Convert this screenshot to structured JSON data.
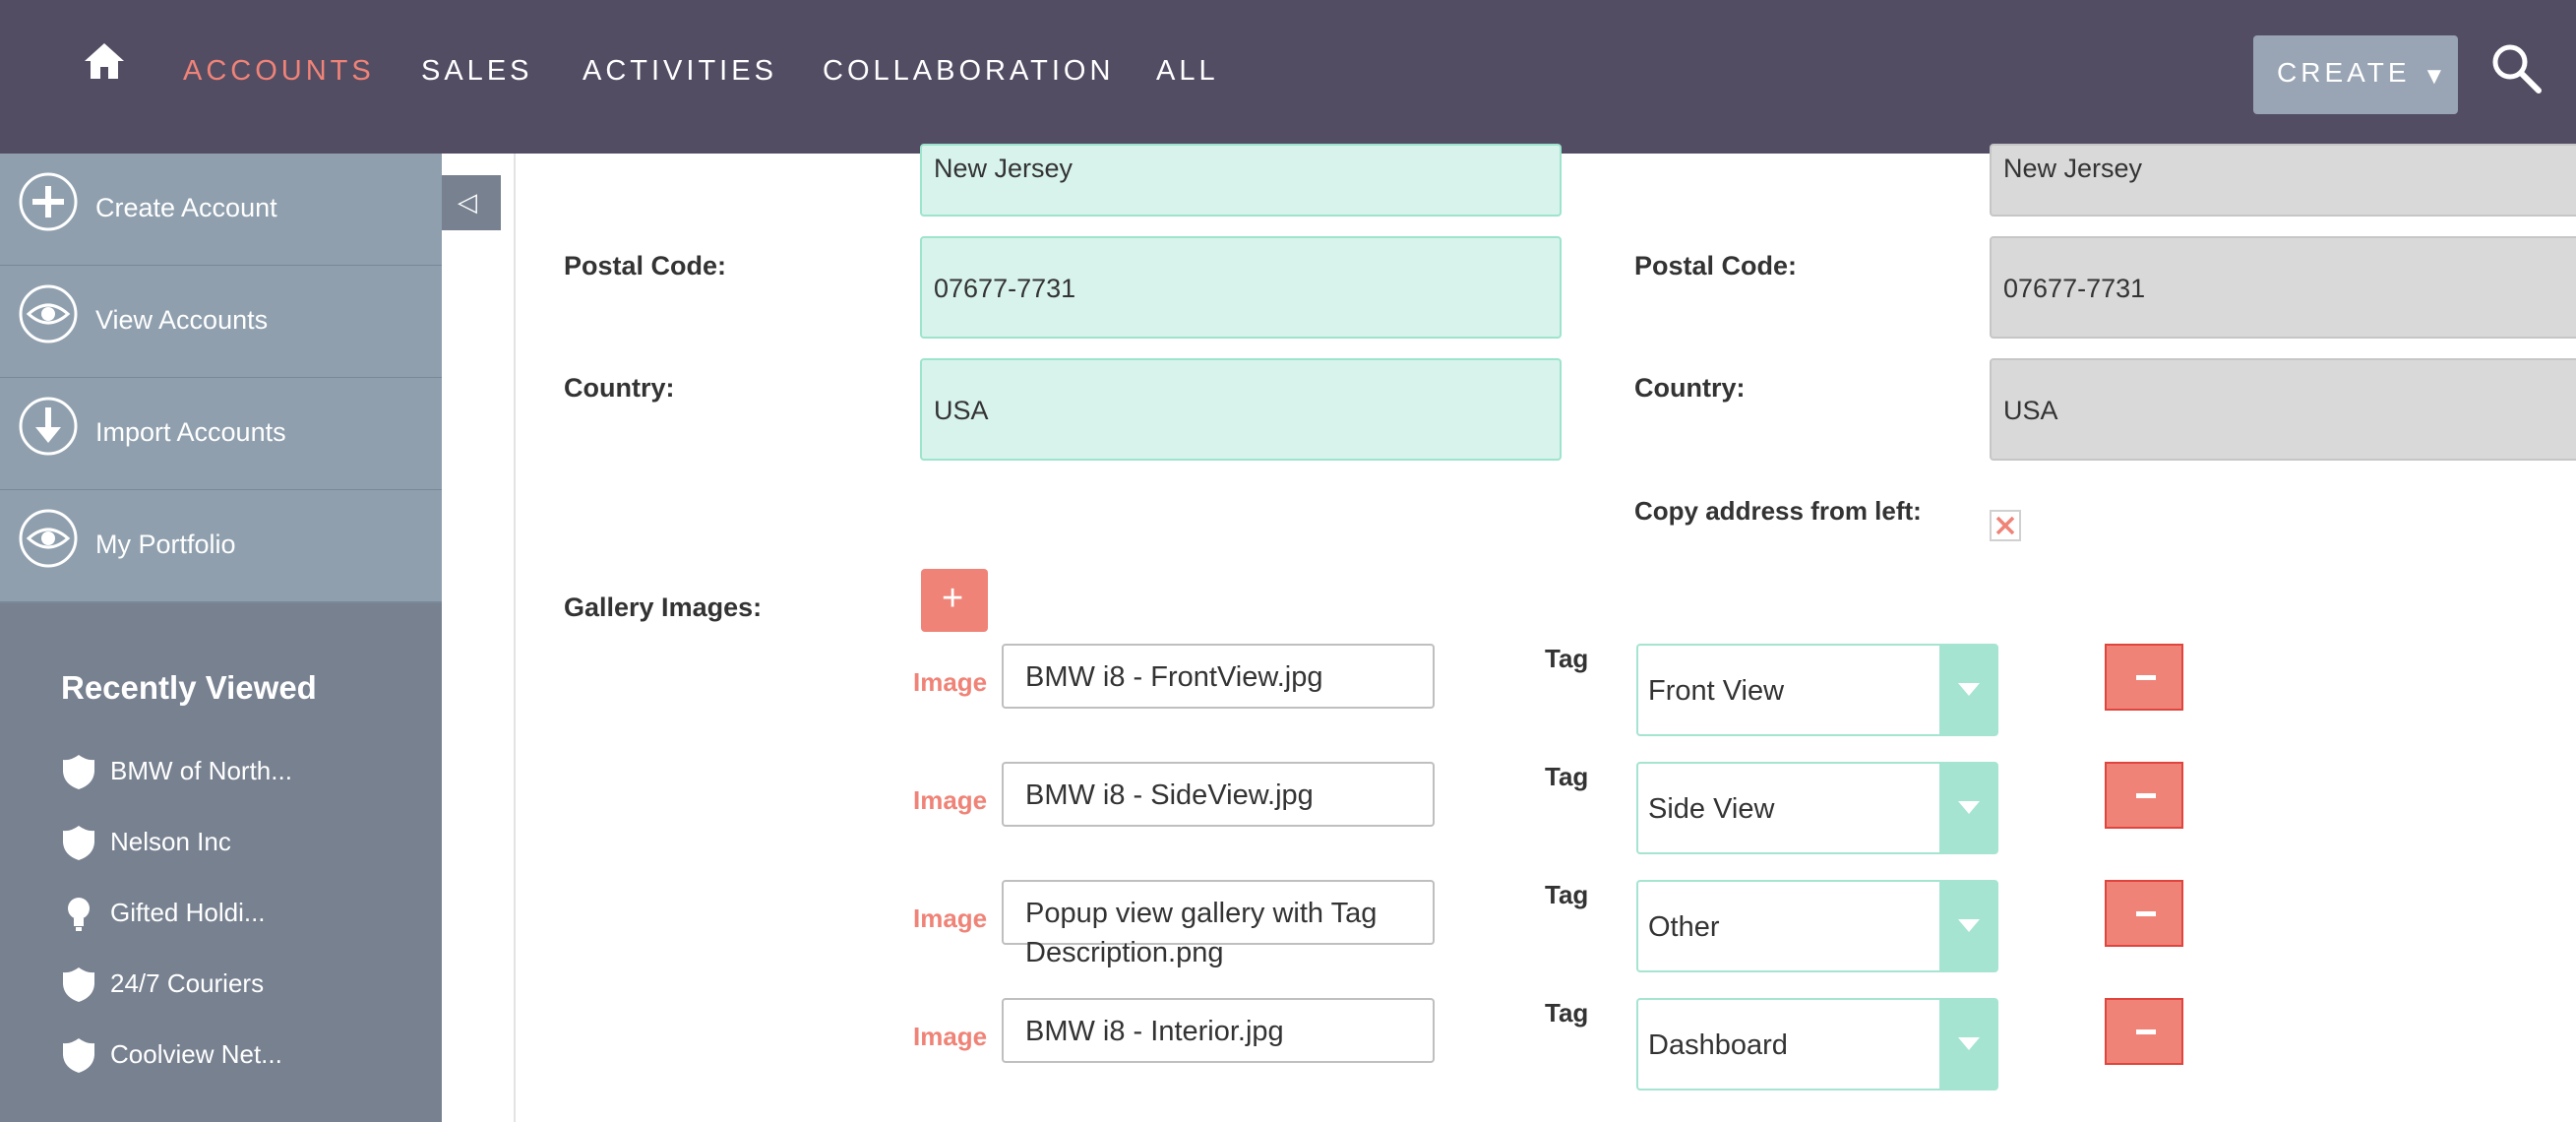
{
  "nav": {
    "items": [
      {
        "label": "ACCOUNTS",
        "active": true
      },
      {
        "label": "SALES",
        "active": false
      },
      {
        "label": "ACTIVITIES",
        "active": false
      },
      {
        "label": "COLLABORATION",
        "active": false
      },
      {
        "label": "ALL",
        "active": false
      }
    ],
    "create_label": "CREATE",
    "create_caret": "▼",
    "colors": {
      "bar": "#534d64",
      "active": "#f08377",
      "create_bg": "#99a5b4"
    }
  },
  "sidebar": {
    "actions": [
      {
        "label": "Create Account",
        "icon": "plus-circle-icon"
      },
      {
        "label": "View Accounts",
        "icon": "eye-icon"
      },
      {
        "label": "Import Accounts",
        "icon": "download-arrow-icon"
      },
      {
        "label": "My Portfolio",
        "icon": "eye-icon"
      }
    ],
    "recently_viewed_title": "Recently Viewed",
    "recent_items": [
      {
        "label": "BMW of North...",
        "icon": "shield-icon"
      },
      {
        "label": "Nelson Inc",
        "icon": "shield-icon"
      },
      {
        "label": "Gifted Holdi...",
        "icon": "lightbulb-icon"
      },
      {
        "label": "24/7 Couriers",
        "icon": "shield-icon"
      },
      {
        "label": "Coolview Net...",
        "icon": "shield-icon"
      }
    ],
    "collapse_glyph": "◁"
  },
  "form": {
    "billing": {
      "state_value": "New Jersey",
      "postal_label": "Postal Code:",
      "postal_value": "07677-7731",
      "country_label": "Country:",
      "country_value": "USA"
    },
    "shipping": {
      "state_value": "New Jersey",
      "postal_label": "Postal Code:",
      "postal_value": "07677-7731",
      "country_label": "Country:",
      "country_value": "USA",
      "copy_label": "Copy address from left:",
      "copy_checked": false
    },
    "gallery": {
      "label": "Gallery Images:",
      "add_glyph": "+",
      "rows": [
        {
          "image_label": "Image",
          "image_value": "BMW i8 - FrontView.jpg",
          "tag_label": "Tag",
          "tag_value": "Front View"
        },
        {
          "image_label": "Image",
          "image_value": "BMW i8 - SideView.jpg",
          "tag_label": "Tag",
          "tag_value": "Side View"
        },
        {
          "image_label": "Image",
          "image_value": "Popup view gallery with Tag Description.png",
          "tag_label": "Tag",
          "tag_value": "Other"
        },
        {
          "image_label": "Image",
          "image_value": "BMW i8 - Interior.jpg",
          "tag_label": "Tag",
          "tag_value": "Dashboard"
        }
      ]
    },
    "colors": {
      "green_field": "#d8f3ec",
      "grey_field": "#d9d9d9",
      "accent": "#f08377",
      "select_arrow": "#a5e4d1"
    }
  }
}
